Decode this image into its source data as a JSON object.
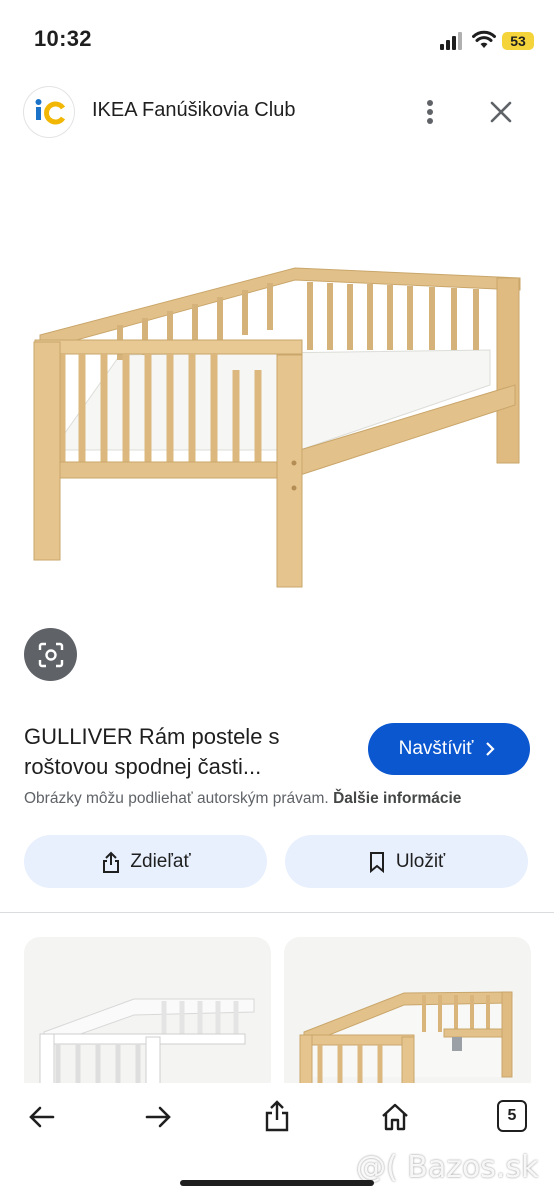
{
  "status_bar": {
    "time": "10:32",
    "battery": "53"
  },
  "header": {
    "title": "IKEA Fanúšikovia Club",
    "logo_text": "iC"
  },
  "result": {
    "title": "GULLIVER Rám postele s roštovou spodnej časti...",
    "visit_label": "Navštíviť",
    "copyright_text": "Obrázky môžu podliehať autorským právam.",
    "more_info_label": "Ďalšie informácie",
    "share_label": "Zdieľať",
    "save_label": "Uložiť"
  },
  "toolbar": {
    "tabs_count": "5"
  },
  "watermark": "@( Bazos.sk",
  "colors": {
    "accent": "#0b57d0",
    "pill_bg": "#e8f0fe",
    "battery": "#f5d33b",
    "wood": "#e6c48e"
  },
  "icons": [
    "signal-icon",
    "wifi-icon",
    "battery-icon",
    "more-vert-icon",
    "close-icon",
    "lens-icon",
    "chevron-right-icon",
    "share-icon",
    "bookmark-icon",
    "back-arrow-icon",
    "forward-arrow-icon",
    "share-toolbar-icon",
    "home-icon",
    "tabs-icon"
  ]
}
